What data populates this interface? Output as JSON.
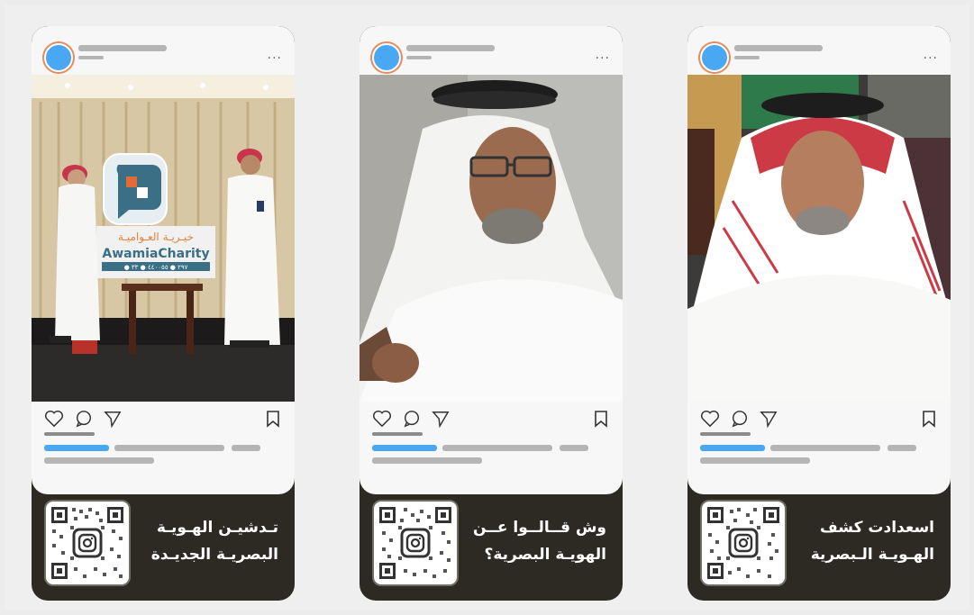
{
  "cards": [
    {
      "caption_line1": "تـدشيـن الهـويـة",
      "caption_line2": "البصريـة الجديـدة",
      "more_label": "..."
    },
    {
      "caption_line1": "وش قــالــوا عــن",
      "caption_line2": "الهويـة البصرية؟",
      "more_label": "..."
    },
    {
      "caption_line1": "اسعدادت كشف",
      "caption_line2": "الهـويـة الـبصرية",
      "more_label": "..."
    }
  ],
  "sign": {
    "arabic": "خيـريـة العـواميـة",
    "latin": "AwamiaCharity",
    "strip": "● ٢٩٧ ● ٤٤٠٠٥٥ ● ٣٣"
  },
  "colors": {
    "accent": "#4aa8f2",
    "caption_bg": "#2c2a22",
    "placeholder": "#b5b5b5"
  },
  "icons": [
    "heart-icon",
    "comment-icon",
    "send-icon",
    "bookmark-icon",
    "qr-code-icon",
    "more-icon"
  ]
}
